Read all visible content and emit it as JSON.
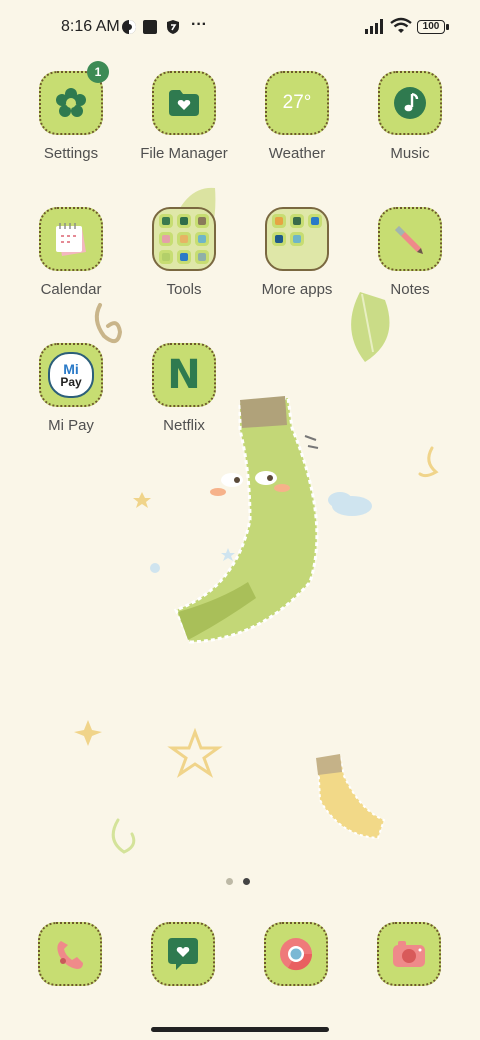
{
  "status_bar": {
    "time": "8:16 AM",
    "battery": "100",
    "icons": [
      "vpn-icon",
      "square-notification-icon",
      "shield-icon",
      "more-icon",
      "signal-icon",
      "wifi-icon",
      "battery-icon"
    ],
    "more": "···"
  },
  "apps": [
    {
      "label": "Settings",
      "icon": "flower-gear-icon",
      "badge": "1"
    },
    {
      "label": "File Manager",
      "icon": "folder-heart-icon"
    },
    {
      "label": "Weather",
      "icon": "weather-icon",
      "temp": "27°"
    },
    {
      "label": "Music",
      "icon": "music-note-icon"
    },
    {
      "label": "Calendar",
      "icon": "calendar-icon"
    },
    {
      "label": "Tools",
      "icon": "folder-icon"
    },
    {
      "label": "More apps",
      "icon": "folder-icon"
    },
    {
      "label": "Notes",
      "icon": "pen-icon"
    },
    {
      "label": "Mi Pay",
      "icon": "mi-pay-icon",
      "brand_top": "Mi",
      "brand_bottom": "Pay"
    },
    {
      "label": "Netflix",
      "icon": "netflix-icon",
      "letter": "N"
    }
  ],
  "dock": [
    {
      "icon": "phone-icon"
    },
    {
      "icon": "messages-icon"
    },
    {
      "icon": "chrome-icon"
    },
    {
      "icon": "camera-icon"
    }
  ],
  "page_indicator": {
    "pages": 2,
    "current": 2
  },
  "colors": {
    "tile": "#c7dd72",
    "badge": "#3d8b55",
    "accent_dark": "#2f7a4f",
    "background": "#faf6e8"
  }
}
